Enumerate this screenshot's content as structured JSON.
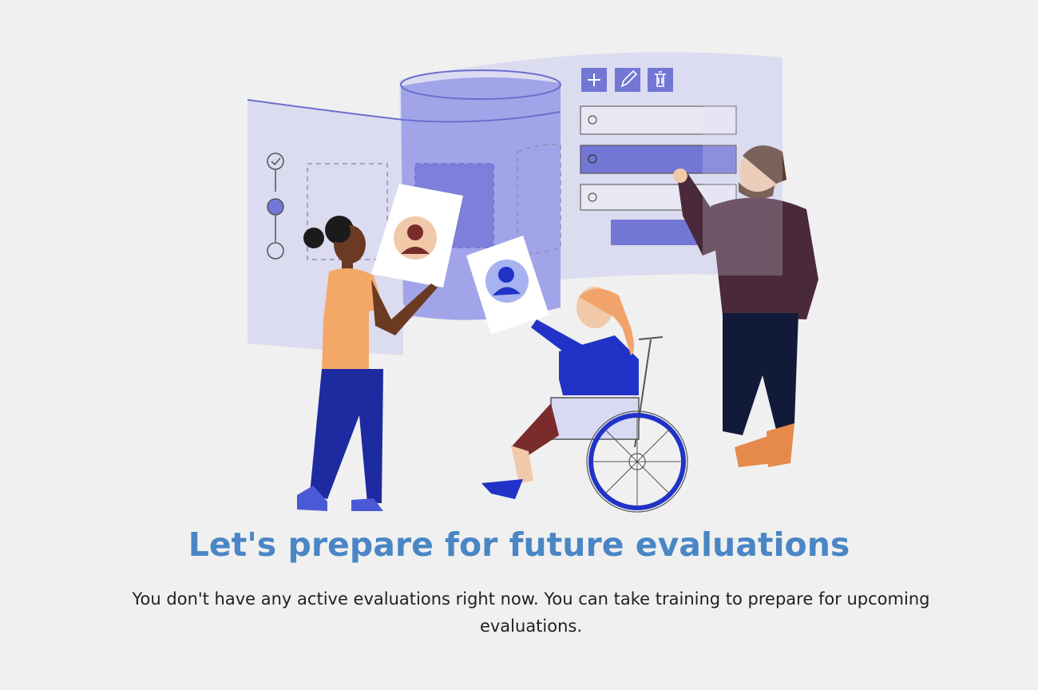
{
  "empty_state": {
    "title": "Let's prepare for future evaluations",
    "description": "You don't have any active evaluations right now. You can take training to prepare for upcoming evaluations."
  },
  "illustration": {
    "toolbar_icons": [
      "plus-icon",
      "pencil-icon",
      "trash-icon"
    ],
    "stepper_states": [
      "completed",
      "current",
      "pending"
    ],
    "profile_icons": [
      "person-icon-brown",
      "person-icon-blue"
    ]
  },
  "colors": {
    "background": "#f0f0f0",
    "title": "#4a86c5",
    "panel": "#d9d9f0",
    "panel_dark": "#9fa2e6",
    "accent": "#7277d6",
    "blue": "#2736c9"
  }
}
